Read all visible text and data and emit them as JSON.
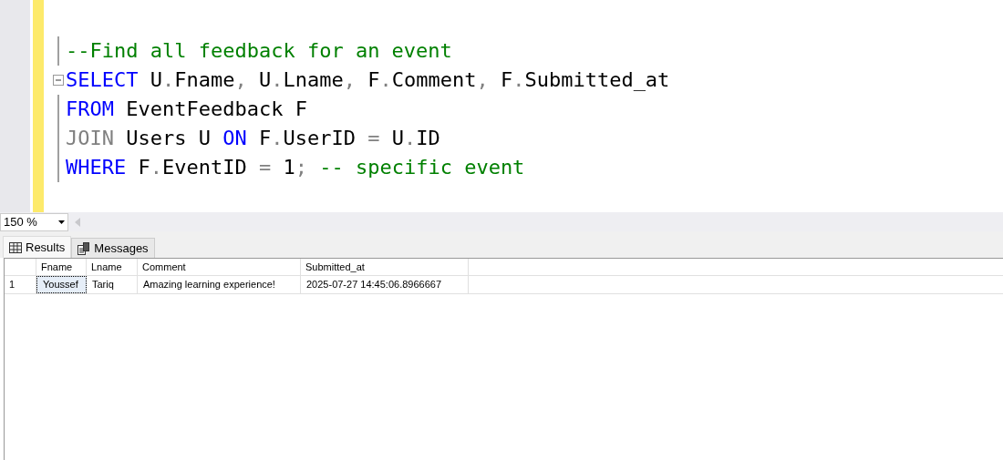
{
  "editor": {
    "lines": [
      {
        "fold": false,
        "tokens": [
          {
            "text": "--Find all feedback for an event",
            "kind": "comment"
          }
        ]
      },
      {
        "fold": true,
        "tokens": [
          {
            "text": "SELECT",
            "kind": "keyword"
          },
          {
            "text": " U",
            "kind": "plain"
          },
          {
            "text": ".",
            "kind": "operator"
          },
          {
            "text": "Fname",
            "kind": "plain"
          },
          {
            "text": ", ",
            "kind": "operator"
          },
          {
            "text": "U",
            "kind": "plain"
          },
          {
            "text": ".",
            "kind": "operator"
          },
          {
            "text": "Lname",
            "kind": "plain"
          },
          {
            "text": ", ",
            "kind": "operator"
          },
          {
            "text": "F",
            "kind": "plain"
          },
          {
            "text": ".",
            "kind": "operator"
          },
          {
            "text": "Comment",
            "kind": "plain"
          },
          {
            "text": ", ",
            "kind": "operator"
          },
          {
            "text": "F",
            "kind": "plain"
          },
          {
            "text": ".",
            "kind": "operator"
          },
          {
            "text": "Submitted_at",
            "kind": "plain"
          }
        ]
      },
      {
        "fold": false,
        "tokens": [
          {
            "text": "FROM",
            "kind": "keyword"
          },
          {
            "text": " EventFeedback F",
            "kind": "plain"
          }
        ]
      },
      {
        "fold": false,
        "tokens": [
          {
            "text": "JOIN",
            "kind": "operator"
          },
          {
            "text": " Users U ",
            "kind": "plain"
          },
          {
            "text": "ON",
            "kind": "keyword"
          },
          {
            "text": " F",
            "kind": "plain"
          },
          {
            "text": ".",
            "kind": "operator"
          },
          {
            "text": "UserID ",
            "kind": "plain"
          },
          {
            "text": "=",
            "kind": "operator"
          },
          {
            "text": " U",
            "kind": "plain"
          },
          {
            "text": ".",
            "kind": "operator"
          },
          {
            "text": "ID",
            "kind": "plain"
          }
        ]
      },
      {
        "fold": false,
        "tokens": [
          {
            "text": "WHERE",
            "kind": "keyword"
          },
          {
            "text": " F",
            "kind": "plain"
          },
          {
            "text": ".",
            "kind": "operator"
          },
          {
            "text": "EventID ",
            "kind": "plain"
          },
          {
            "text": "=",
            "kind": "operator"
          },
          {
            "text": " 1",
            "kind": "plain"
          },
          {
            "text": ";",
            "kind": "operator"
          },
          {
            "text": " -- specific event",
            "kind": "comment"
          }
        ]
      }
    ]
  },
  "zoom": {
    "value": "150 %"
  },
  "tabs": [
    {
      "label": "Results",
      "selected": true,
      "kind": "grid"
    },
    {
      "label": "Messages",
      "selected": false,
      "kind": "messages"
    }
  ],
  "table": {
    "columns": [
      "Fname",
      "Lname",
      "Comment",
      "Submitted_at"
    ],
    "rows": [
      {
        "number": "1",
        "cells": [
          "Youssef",
          "Tariq",
          "Amazing learning experience!",
          "2025-07-27 14:45:06.8966667"
        ]
      }
    ]
  }
}
